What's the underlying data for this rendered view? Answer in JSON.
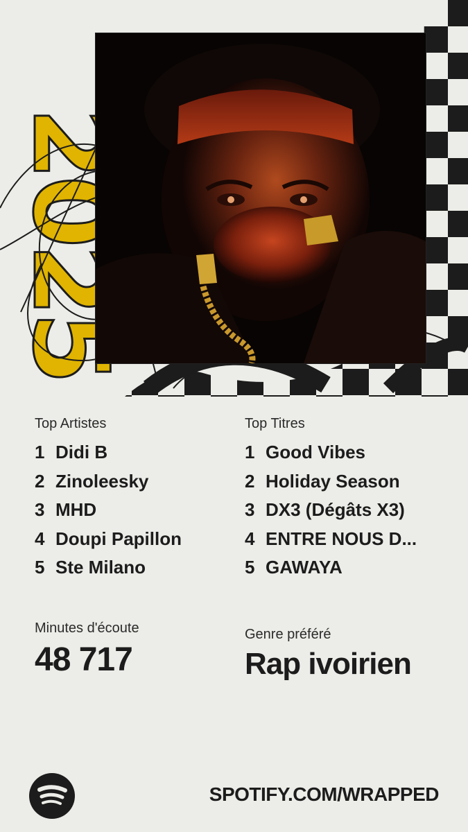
{
  "hero": {
    "year": "2025",
    "colors": {
      "year_fill": "#e0b400",
      "checker_dark": "#1c1c1c",
      "checker_light": "#ecece8"
    }
  },
  "top_artists": {
    "title": "Top Artistes",
    "items": [
      {
        "rank": "1",
        "name": "Didi B"
      },
      {
        "rank": "2",
        "name": "Zinoleesky"
      },
      {
        "rank": "3",
        "name": "MHD"
      },
      {
        "rank": "4",
        "name": "Doupi Papillon"
      },
      {
        "rank": "5",
        "name": "Ste Milano"
      }
    ]
  },
  "top_tracks": {
    "title": "Top Titres",
    "items": [
      {
        "rank": "1",
        "name": "Good Vibes"
      },
      {
        "rank": "2",
        "name": "Holiday Season"
      },
      {
        "rank": "3",
        "name": "DX3 (Dégâts X3)"
      },
      {
        "rank": "4",
        "name": "ENTRE NOUS D..."
      },
      {
        "rank": "5",
        "name": "GAWAYA"
      }
    ]
  },
  "minutes": {
    "label": "Minutes d'écoute",
    "value": "48 717"
  },
  "genre": {
    "label": "Genre préféré",
    "value": "Rap ivoirien"
  },
  "footer": {
    "logo_icon": "spotify-logo-icon",
    "url": "SPOTIFY.COM/WRAPPED"
  }
}
